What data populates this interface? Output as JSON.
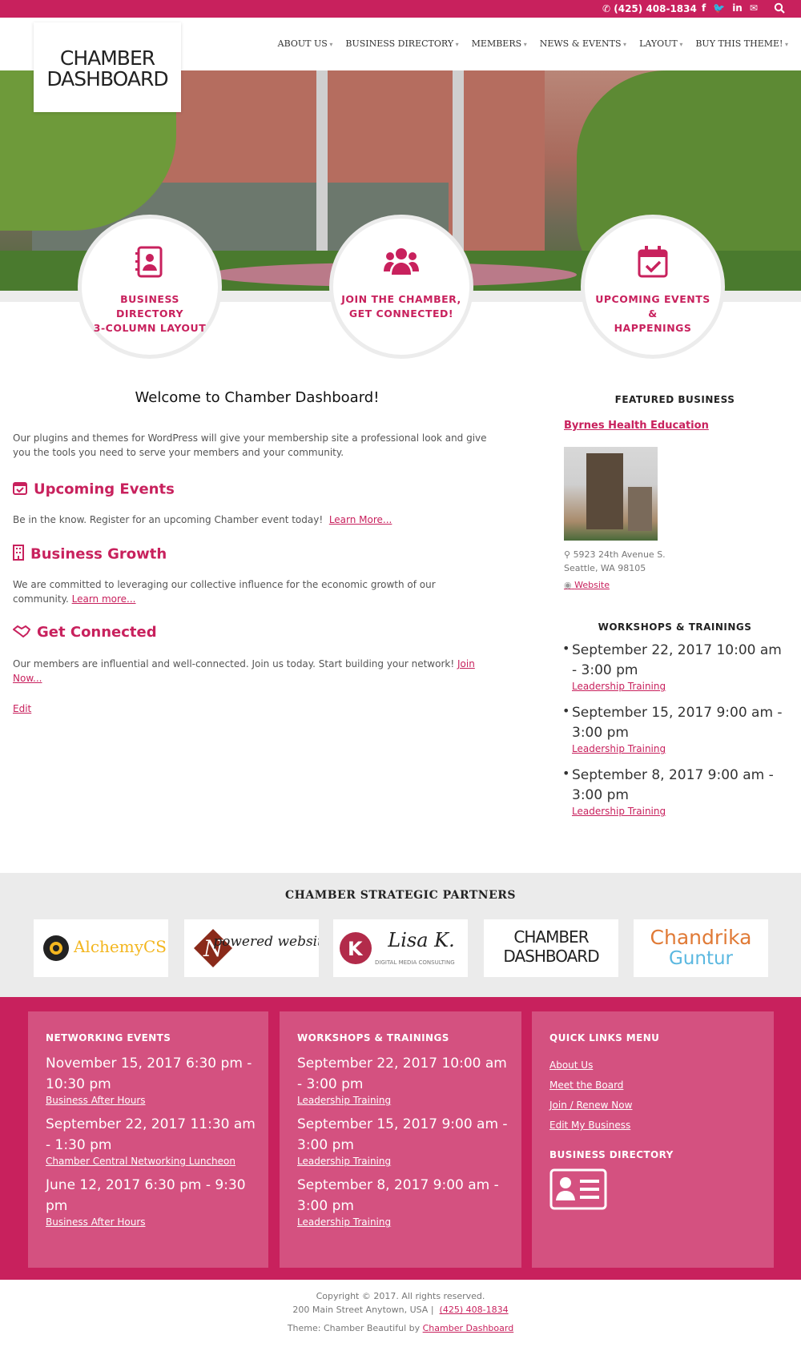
{
  "topbar": {
    "phone": "(425) 408-1834"
  },
  "logo": {
    "line1": "CHAMBER",
    "line2": "DASHBOARD"
  },
  "nav": [
    "ABOUT US",
    "BUSINESS DIRECTORY",
    "MEMBERS",
    "NEWS & EVENTS",
    "LAYOUT",
    "BUY THIS THEME!"
  ],
  "features": [
    {
      "line1": "BUSINESS DIRECTORY",
      "line2": "3-COLUMN LAYOUT",
      "icon": "address-book-icon"
    },
    {
      "line1": "JOIN THE CHAMBER,",
      "line2": "GET CONNECTED!",
      "icon": "users-icon"
    },
    {
      "line1": "UPCOMING EVENTS &",
      "line2": "HAPPENINGS",
      "icon": "calendar-check-icon"
    }
  ],
  "main": {
    "title": "Welcome to Chamber Dashboard!",
    "intro": "Our plugins and themes for WordPress will give your membership site a professional look and give you the tools you need to serve your members and your community.",
    "sections": [
      {
        "heading": "Upcoming Events",
        "text": "Be in the know. Register for an upcoming Chamber event today!",
        "link": "Learn More..."
      },
      {
        "heading": "Business Growth",
        "text": "We are committed to leveraging our collective influence for the economic growth of our community.",
        "link": "Learn more..."
      },
      {
        "heading": "Get Connected",
        "text": "Our members are influential and well-connected. Join us today. Start building your network!",
        "link": "Join Now..."
      }
    ],
    "edit": "Edit"
  },
  "sidebar": {
    "featured_title": "FEATURED BUSINESS",
    "business_name": "Byrnes Health Education",
    "address1": "5923 24th Avenue S.",
    "address2": "Seattle, WA 98105",
    "website": "Website",
    "workshops_title": "WORKSHOPS & TRAININGS",
    "workshops": [
      {
        "date": "September 22, 2017 10:00 am - 3:00 pm",
        "title": "Leadership Training"
      },
      {
        "date": "September 15, 2017 9:00 am - 3:00 pm",
        "title": "Leadership Training"
      },
      {
        "date": "September 8, 2017 9:00 am - 3:00 pm",
        "title": "Leadership Training"
      }
    ]
  },
  "partners": {
    "title": "CHAMBER STRATEGIC PARTNERS",
    "logos": [
      "AlchemyCS",
      "powered websites",
      "Lisa K.",
      "CHAMBER DASHBOARD",
      "Chandrika Guntur"
    ],
    "sublabels": {
      "lisa": "DIGITAL MEDIA CONSULTING",
      "chandrika2": "Guntur",
      "chandrika1": "Chandrika"
    }
  },
  "footer": {
    "networking_title": "NETWORKING EVENTS",
    "networking": [
      {
        "date": "November 15, 2017 6:30 pm - 10:30 pm",
        "title": "Business After Hours"
      },
      {
        "date": "September 22, 2017 11:30 am - 1:30 pm",
        "title": "Chamber Central Networking Luncheon"
      },
      {
        "date": "June 12, 2017 6:30 pm - 9:30 pm",
        "title": "Business After Hours"
      }
    ],
    "workshops_title": "WORKSHOPS & TRAININGS",
    "workshops": [
      {
        "date": "September 22, 2017 10:00 am - 3:00 pm",
        "title": "Leadership Training"
      },
      {
        "date": "September 15, 2017 9:00 am - 3:00 pm",
        "title": "Leadership Training"
      },
      {
        "date": "September 8, 2017 9:00 am - 3:00 pm",
        "title": "Leadership Training"
      }
    ],
    "quicklinks_title": "QUICK LINKS MENU",
    "quicklinks": [
      "About Us",
      "Meet the Board",
      "Join / Renew Now",
      "Edit My Business"
    ],
    "directory_title": "BUSINESS DIRECTORY"
  },
  "copyright": {
    "line1": "Copyright © 2017. All rights reserved.",
    "line2_address": "200 Main Street   Anytown, USA   |",
    "line2_phone": "(425) 408-1834",
    "line3_prefix": "Theme: Chamber Beautiful by",
    "line3_link": "Chamber Dashboard"
  },
  "colors": {
    "accent": "#c8215d",
    "band": "#ececec"
  }
}
